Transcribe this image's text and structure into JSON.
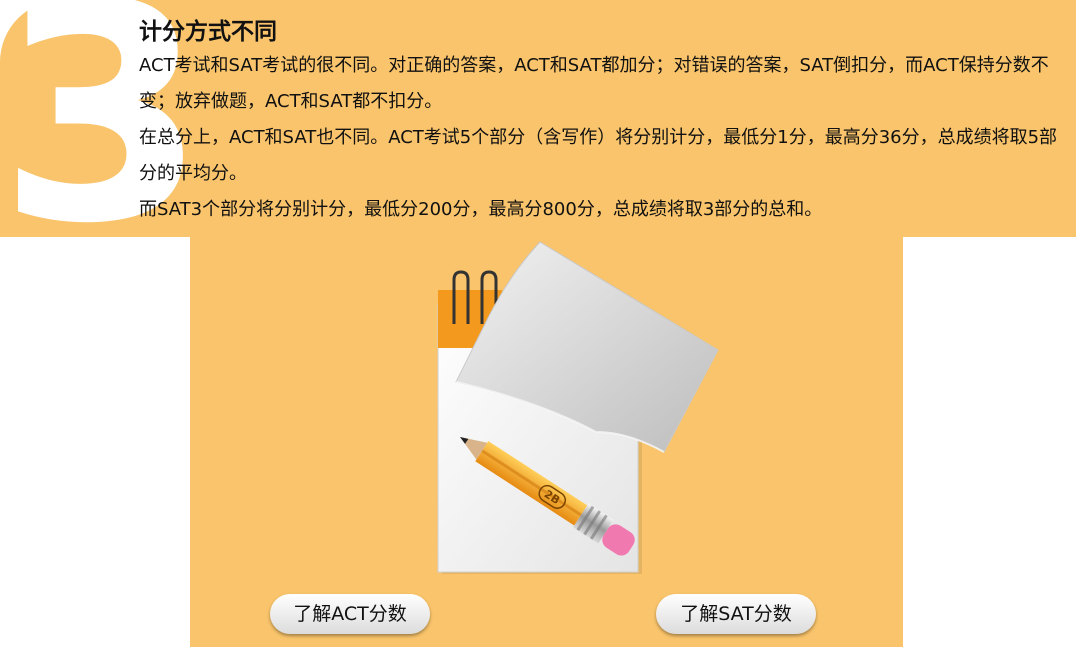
{
  "section": {
    "number": "3",
    "title": "计分方式不同",
    "paragraphs": [
      "ACT考试和SAT考试的很不同。对正确的答案，ACT和SAT都加分；对错误的答案，SAT倒扣分，而ACT保持分数不变；放弃做题，ACT和SAT都不扣分。",
      "在总分上，ACT和SAT也不同。ACT考试5个部分（含写作）将分别计分，最低分1分，最高分36分，总成绩将取5部分的平均分。",
      "而SAT3个部分将分别计分，最低分200分，最高分800分，总成绩将取3部分的总和。"
    ]
  },
  "illustration": {
    "icon": "notepad-pencil-icon",
    "pencil_label": "2B"
  },
  "buttons": {
    "act_label": "了解ACT分数",
    "sat_label": "了解SAT分数"
  },
  "colors": {
    "panel": "#f9c46b",
    "pencil": "#f5a623",
    "eraser": "#f07ab0"
  }
}
